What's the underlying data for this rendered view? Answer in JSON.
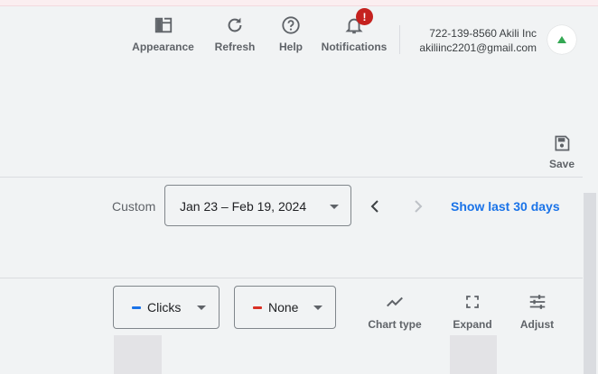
{
  "header": {
    "toolbar": [
      {
        "label": "Appearance",
        "icon": "appearance-icon"
      },
      {
        "label": "Refresh",
        "icon": "refresh-icon"
      },
      {
        "label": "Help",
        "icon": "help-icon"
      },
      {
        "label": "Notifications",
        "icon": "bell-icon",
        "badge": "!"
      }
    ],
    "account": {
      "line1": "722-139-8560 Akili Inc",
      "line2": "akiliinc2201@gmail.com"
    }
  },
  "save": {
    "label": "Save",
    "icon": "save-icon"
  },
  "date_range": {
    "prefix": "Custom",
    "value": "Jan 23 – Feb 19, 2024",
    "show_last": "Show last 30 days"
  },
  "metrics": {
    "primary": {
      "label": "Clicks",
      "color": "#1a73e8"
    },
    "secondary": {
      "label": "None",
      "color": "#d93025"
    }
  },
  "tools": [
    {
      "label": "Chart type",
      "icon": "chart-type-icon"
    },
    {
      "label": "Expand",
      "icon": "expand-icon"
    },
    {
      "label": "Adjust",
      "icon": "adjust-icon"
    }
  ],
  "colors": {
    "background": "#f1f3f4",
    "link": "#1a73e8",
    "badge": "#c5221f",
    "avatar_accent": "#34a853"
  }
}
